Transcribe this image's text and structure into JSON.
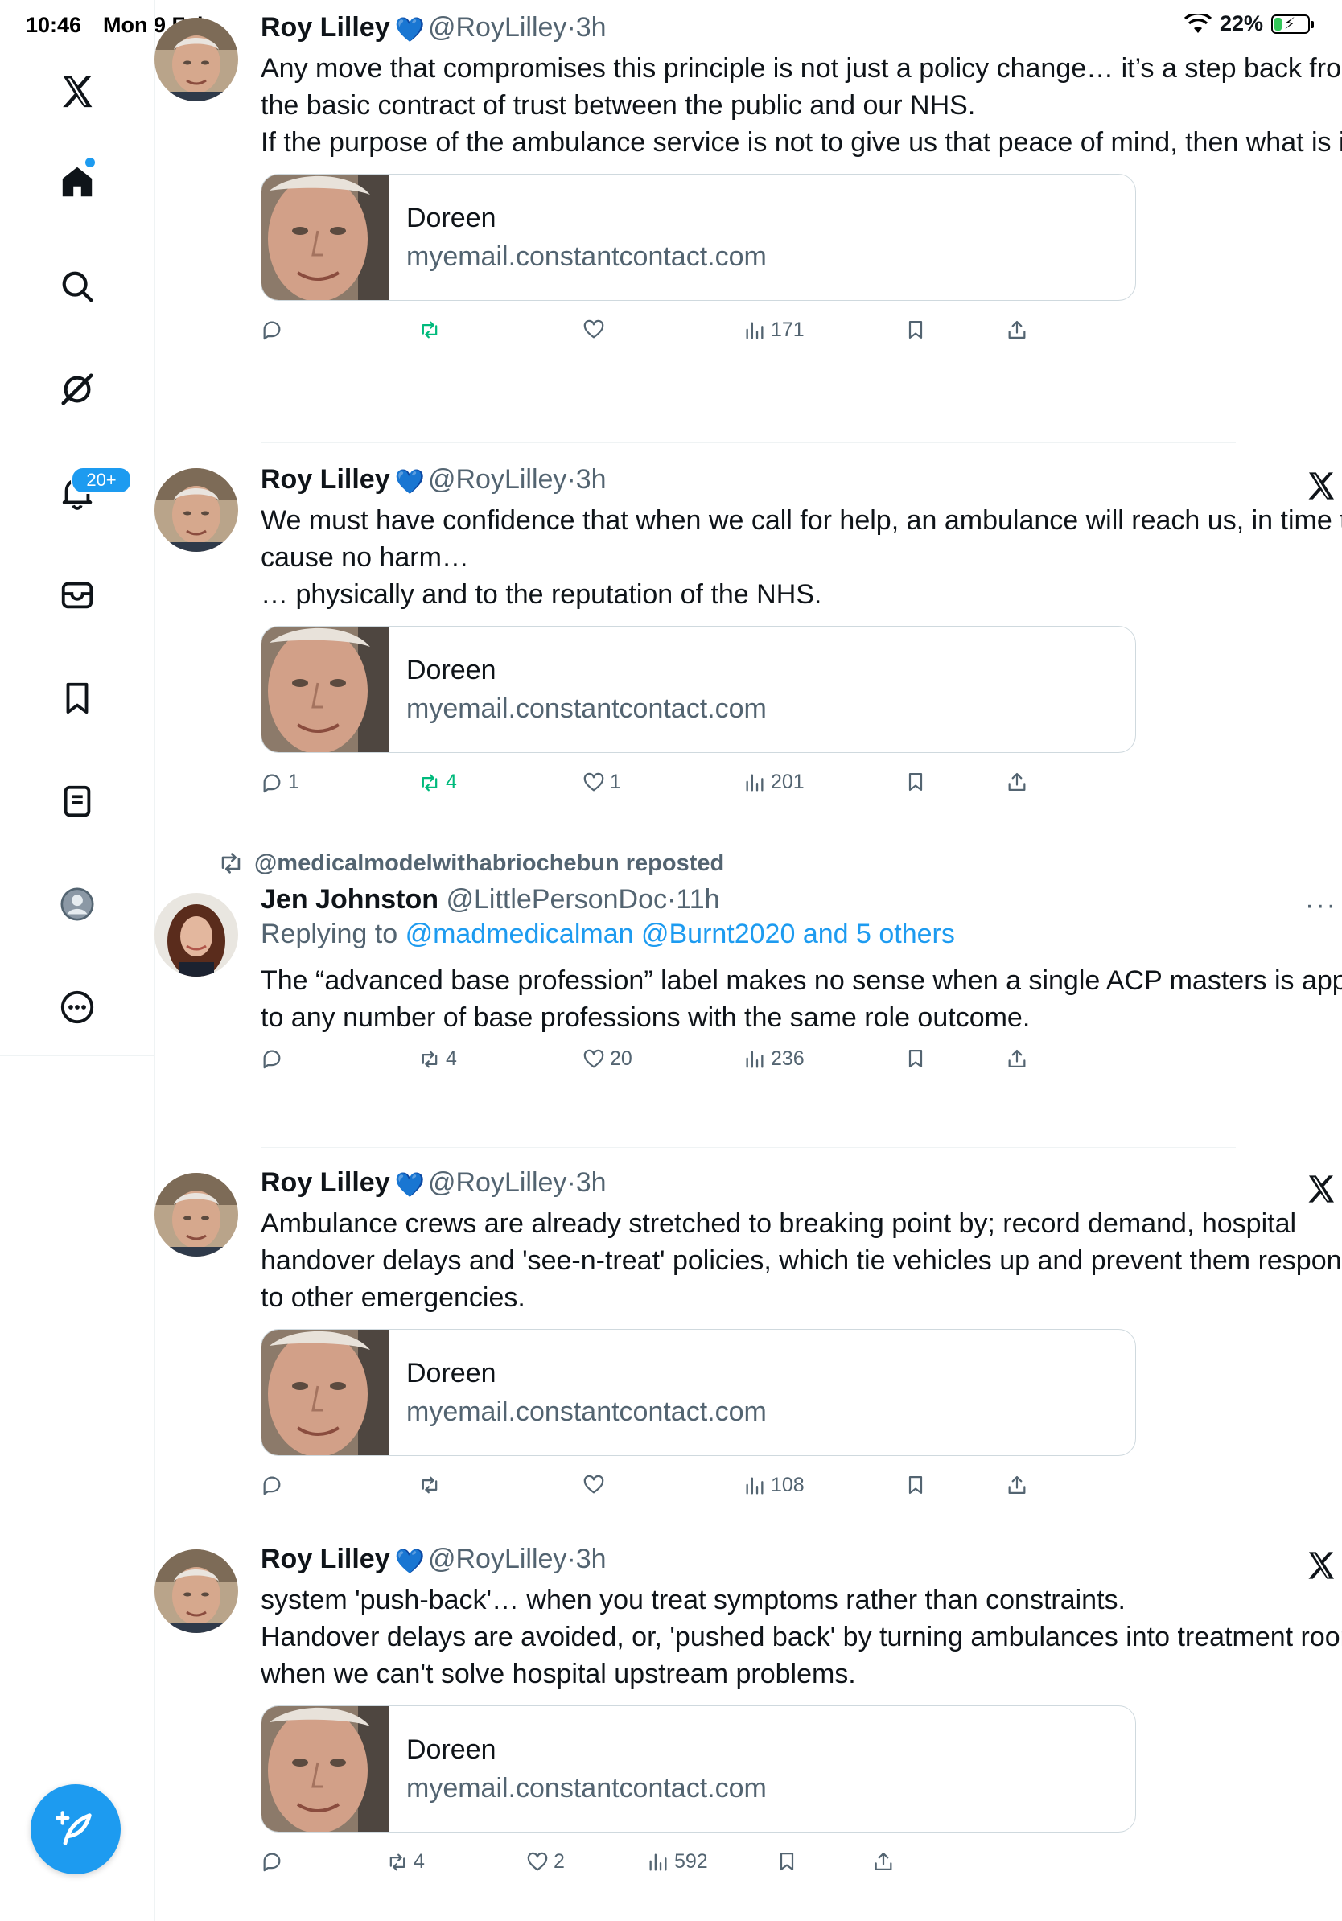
{
  "status_bar": {
    "time": "10:46",
    "date": "Mon 9 Feb",
    "battery": "22%",
    "battery_level": 0.22
  },
  "sidebar": {
    "notification_count": "20+",
    "items": [
      "x-logo",
      "home-icon",
      "search-icon",
      "grok-icon",
      "notifications-icon",
      "messages-icon",
      "bookmarks-icon",
      "lists-icon",
      "profile-icon",
      "more-icon"
    ]
  },
  "colors": {
    "accent": "#1d9bf0",
    "repost_green": "#00ba7c",
    "muted": "#536471",
    "text": "#0f1419",
    "border": "#cfd9de"
  },
  "tweets": [
    {
      "name": "Roy Lilley",
      "handle": "@RoyLilley",
      "time": "3h",
      "lines": [
        "Any move that compromises this principle is not just a policy change… it’s a step back from the basic contract of trust between the public and our NHS.",
        "If the purpose of the ambulance service is not to give us that peace of mind, then what is it?"
      ],
      "card_title": "Doreen",
      "card_domain": "myemail.constantcontact.com",
      "replies": "",
      "reposts": "",
      "likes": "",
      "views": "171"
    },
    {
      "name": "Roy Lilley",
      "handle": "@RoyLilley",
      "time": "3h",
      "lines": [
        "We must have confidence that when we call for help, an ambulance will reach us, in time to cause no harm…",
        "… physically and to the reputation of the NHS."
      ],
      "card_title": "Doreen",
      "card_domain": "myemail.constantcontact.com",
      "replies": "1",
      "reposts": "4",
      "likes": "1",
      "views": "201"
    },
    {
      "repost_label": "@medicalmodelwithabriochebun reposted",
      "name": "Jen Johnston",
      "handle": "@LittlePersonDoc",
      "time": "11h",
      "replying_prefix": "Replying to",
      "replying_to": "@madmedicalman @Burnt2020 and 5 others",
      "lines": [
        "The “advanced base profession” label makes no sense when a single ACP masters is applied to any number of base professions with the same role outcome."
      ],
      "replies": "",
      "reposts": "4",
      "likes": "20",
      "views": "236"
    },
    {
      "name": "Roy Lilley",
      "handle": "@RoyLilley",
      "time": "3h",
      "lines": [
        "Ambulance crews are already stretched to breaking point by; record demand, hospital handover delays and 'see-n-treat' policies, which tie vehicles up and prevent them responding to other emergencies."
      ],
      "card_title": "Doreen",
      "card_domain": "myemail.constantcontact.com",
      "replies": "",
      "reposts": "",
      "likes": "",
      "views": "108"
    },
    {
      "name": "Roy Lilley",
      "handle": "@RoyLilley",
      "time": "3h",
      "lines": [
        "system 'push-back'… when you treat symptoms rather than constraints.",
        "Handover delays are avoided, or, 'pushed back' by turning ambulances into treatment rooms, when we can't solve hospital upstream problems."
      ],
      "card_title": "Doreen",
      "card_domain": "myemail.constantcontact.com",
      "replies": "",
      "reposts": "4",
      "likes": "2",
      "views": "592"
    }
  ]
}
